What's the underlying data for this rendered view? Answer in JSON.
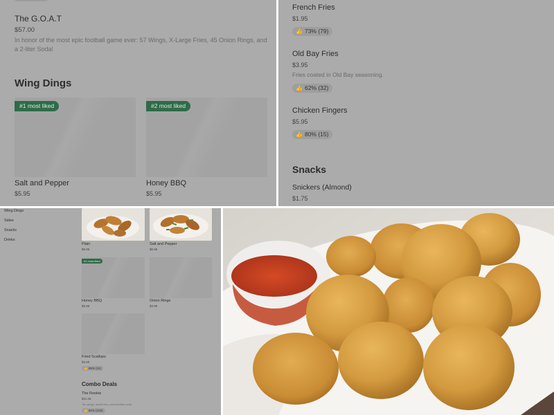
{
  "top_left": {
    "goat": {
      "name": "The G.O.A.T",
      "price": "$57.00",
      "description": "In honor of the most epic football game ever: 57 Wings, X-Large Fries, 45 Onion Rings, and a 2-liter Soda!"
    },
    "section_title": "Wing Dings",
    "cards": [
      {
        "badge": "#1 most liked",
        "name": "Salt and Pepper",
        "price": "$5.95"
      },
      {
        "badge": "#2 most liked",
        "name": "Honey BBQ",
        "price": "$5.95"
      }
    ]
  },
  "top_right": {
    "items": [
      {
        "name": "French Fries",
        "price": "$1.95",
        "description": "",
        "rating": "73% (79)"
      },
      {
        "name": "Old Bay Fries",
        "price": "$3.95",
        "description": "Fries coated in Old Bay seasoning.",
        "rating": "62% (32)"
      },
      {
        "name": "Chicken Fingers",
        "price": "$5.95",
        "description": "",
        "rating": "80% (15)"
      }
    ],
    "section_title": "Snacks",
    "snack": {
      "name": "Snickers (Almond)",
      "price": "$1.75"
    }
  },
  "bottom_left": {
    "nav": [
      "Wing Dings",
      "Sides",
      "Snacks",
      "Drinks"
    ],
    "grid": [
      {
        "name": "Plain",
        "price": "$5.95",
        "badge": "",
        "rating": ""
      },
      {
        "name": "Salt and Pepper",
        "price": "$5.95",
        "badge": "",
        "rating": ""
      },
      {
        "name": "Honey BBQ",
        "price": "$5.95",
        "badge": "#1 most liked",
        "rating": ""
      },
      {
        "name": "Onion Rings",
        "price": "$3.95",
        "badge": "",
        "rating": ""
      },
      {
        "name": "Fried Scallops",
        "price": "$4.50",
        "badge": "",
        "rating": "86% (22)"
      }
    ],
    "combo_title": "Combo Deals",
    "combo": {
      "name": "The Rookie",
      "price": "$11.25",
      "description": "Ten wings, small fries, and medium soda",
      "rating": "82% (102)"
    }
  },
  "icons": {
    "thumb": "thumbs-up-icon"
  },
  "colors": {
    "badge_green": "#2f6b49",
    "overlay_gray": "#ababab"
  }
}
